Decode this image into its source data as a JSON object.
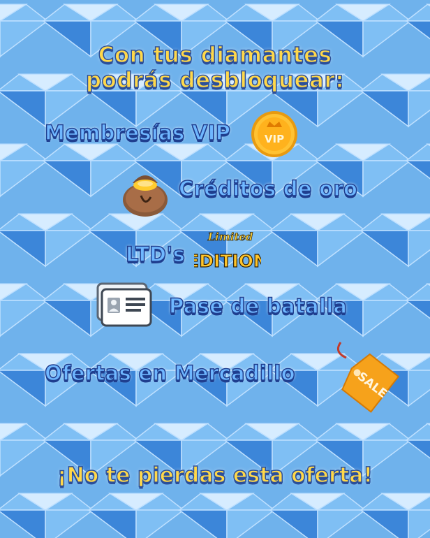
{
  "title": {
    "line1": "Con tus diamantes",
    "line2": "podrás desbloquear:"
  },
  "items": [
    {
      "label": "Membresías VIP",
      "icon": "vip-coin-icon"
    },
    {
      "label": "Créditos de oro",
      "icon": "gold-bag-icon"
    },
    {
      "label": "LTD's",
      "icon": "limited-edition-icon"
    },
    {
      "label": "Pase de batalla",
      "icon": "id-card-icon"
    },
    {
      "label": "Ofertas en Mercadillo",
      "icon": "sale-tag-icon"
    }
  ],
  "badges": {
    "vip": "VIP",
    "limited": "Limited",
    "edition": "EDITION",
    "sale": "SALE"
  },
  "footer": "¡No te pierdas esta oferta!",
  "colors": {
    "title_fill": "#ffd84a",
    "title_outline": "#2b4f9a",
    "item_fill": "#6fb7ff",
    "item_outline": "#1f3e8f",
    "gem_light": "#d6ecff",
    "gem_mid": "#7fbff4",
    "gem_dark": "#3c86d9"
  }
}
